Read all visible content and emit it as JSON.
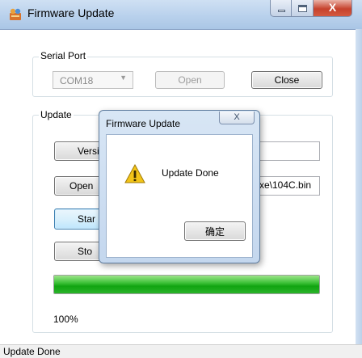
{
  "window": {
    "title": "Firmware Update",
    "close_glyph": "X"
  },
  "serial_port": {
    "label": "Serial Port",
    "port_value": "COM18",
    "open_label": "Open",
    "close_label": "Close"
  },
  "update": {
    "label": "Update",
    "version_label": "Versi",
    "open_file_label": "Open",
    "file_path": "xe\\104C.bin",
    "start_label": "Star",
    "stop_label": "Sto",
    "progress_percent": 100,
    "progress_text": "100%"
  },
  "dialog": {
    "title": "Firmware Update",
    "close_glyph": "X",
    "message": "Update Done",
    "ok_label": "确定",
    "icon": "warning-icon"
  },
  "status": {
    "text": "Update Done"
  },
  "colors": {
    "progress_fill": "#11a411",
    "titlebar": "#b9d1ec"
  }
}
